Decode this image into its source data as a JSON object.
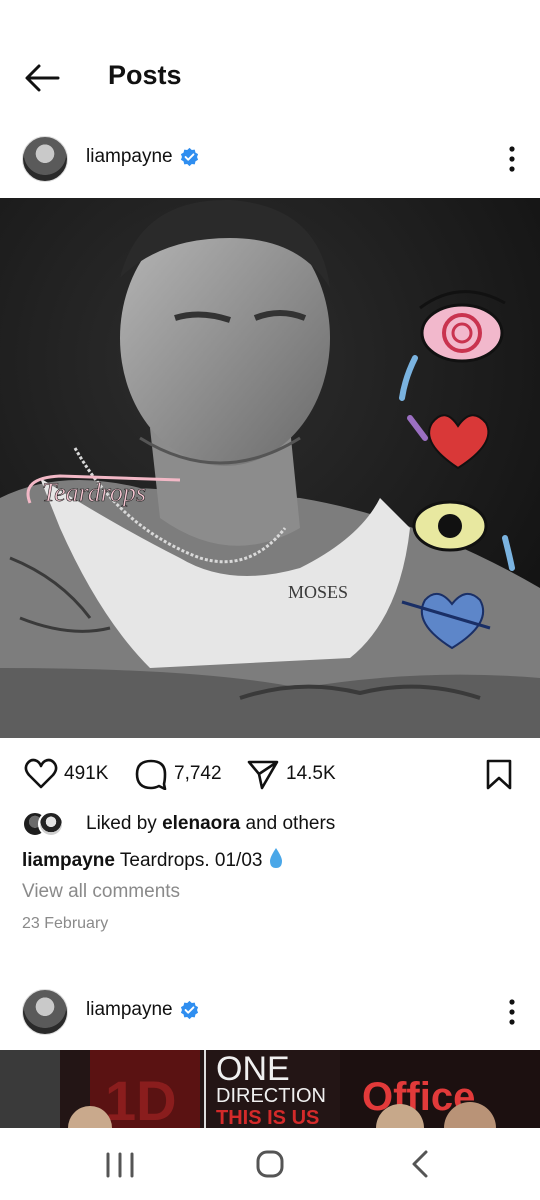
{
  "header": {
    "title": "Posts"
  },
  "posts": [
    {
      "username": "liampayne",
      "image_text": "Teardrops",
      "likes": "491K",
      "comments": "7,742",
      "shares": "14.5K",
      "liked_by_prefix": "Liked by",
      "liked_by_user": "elenaora",
      "liked_by_suffix": "and others",
      "caption_user": "liampayne",
      "caption_text": "Teardrops. 01/03",
      "view_all_comments": "View all comments",
      "date": "23 February"
    },
    {
      "username": "liampayne",
      "banner_text_1": "ONE",
      "banner_text_2": "DIRECTION",
      "banner_text_3": "THIS IS US",
      "banner_text_4": "Office",
      "banner_text_5": "1D"
    }
  ],
  "colors": {
    "verified": "#2f8ef0",
    "water_drop": "#4aa7e8",
    "text_secondary": "#8a8a8a"
  }
}
